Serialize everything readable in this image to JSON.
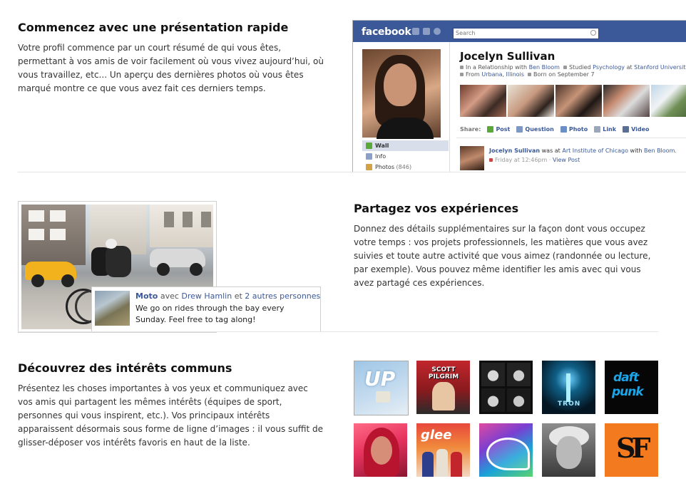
{
  "section1": {
    "title": "Commencez avec une présentation rapide",
    "body": "Votre profil commence par un court résumé de qui vous êtes, permettant à vos amis de voir facilement où vous vivez aujourd’hui, où vous travaillez, etc... Un aperçu des dernières photos où vous êtes marqué montre ce que vous avez fait ces derniers temps."
  },
  "profile_mock": {
    "logo": "facebook",
    "search_placeholder": "Search",
    "name": "Jocelyn Sullivan",
    "info": {
      "rel_prefix": "In a Relationship with ",
      "rel_link": "Ben Bloom",
      "studied_prefix": "Studied ",
      "studied_subject": "Psychology",
      "studied_at": " at ",
      "studied_school": "Stanford University",
      "from_prefix": "From ",
      "from_place": "Urbana, Illinois",
      "born": "Born on September 7"
    },
    "nav": [
      {
        "label": "Wall",
        "count": ""
      },
      {
        "label": "Info",
        "count": ""
      },
      {
        "label": "Photos",
        "count": "(846)"
      }
    ],
    "share": {
      "label": "Share:",
      "items": [
        "Post",
        "Question",
        "Photo",
        "Link",
        "Video"
      ]
    },
    "story": {
      "name": "Jocelyn Sullivan",
      "was_at": " was at ",
      "place": "Art Institute of Chicago",
      "with": " with ",
      "friend": "Ben Bloom.",
      "time": "Friday at 12:46pm",
      "sep": " · ",
      "view": "View Post"
    }
  },
  "section2": {
    "title": "Partagez vos expériences",
    "body": "Donnez des détails supplémentaires sur la façon dont vous occupez votre temps : vos projets professionnels, les matières que vous avez suivies et toute autre activité que vous aimez (randonnée ou lecture, par exemple). Vous pouvez même identifier les amis avec qui vous avez partagé ces expériences."
  },
  "experience_card": {
    "title": "Moto",
    "with": " avec ",
    "friend": "Drew Hamlin",
    "and": " et ",
    "others": "2 autres personnes",
    "text": "We go on rides through the bay every Sunday. Feel free to tag along!"
  },
  "section3": {
    "title": "Découvrez des intérêts communs",
    "body": "Présentez les choses importantes à vos yeux et communiquez avec vos amis qui partagent les mêmes intérêts (équipes de sport, personnes qui vous inspirent, etc.). Vos principaux intérêts apparaissent désormais sous forme de ligne d’images : il vous suffit de glisser-déposer vos intérêts favoris en haut de la liste."
  },
  "interest_tiles": {
    "up": "UP",
    "pilgrim": "SCOTT PILGRIM",
    "tron": "TRON",
    "daft1": "daft",
    "daft2": "punk",
    "glee": "glee",
    "sf": "SF"
  },
  "colors": {
    "facebook_blue": "#3b5998",
    "link_blue": "#3b5998"
  }
}
